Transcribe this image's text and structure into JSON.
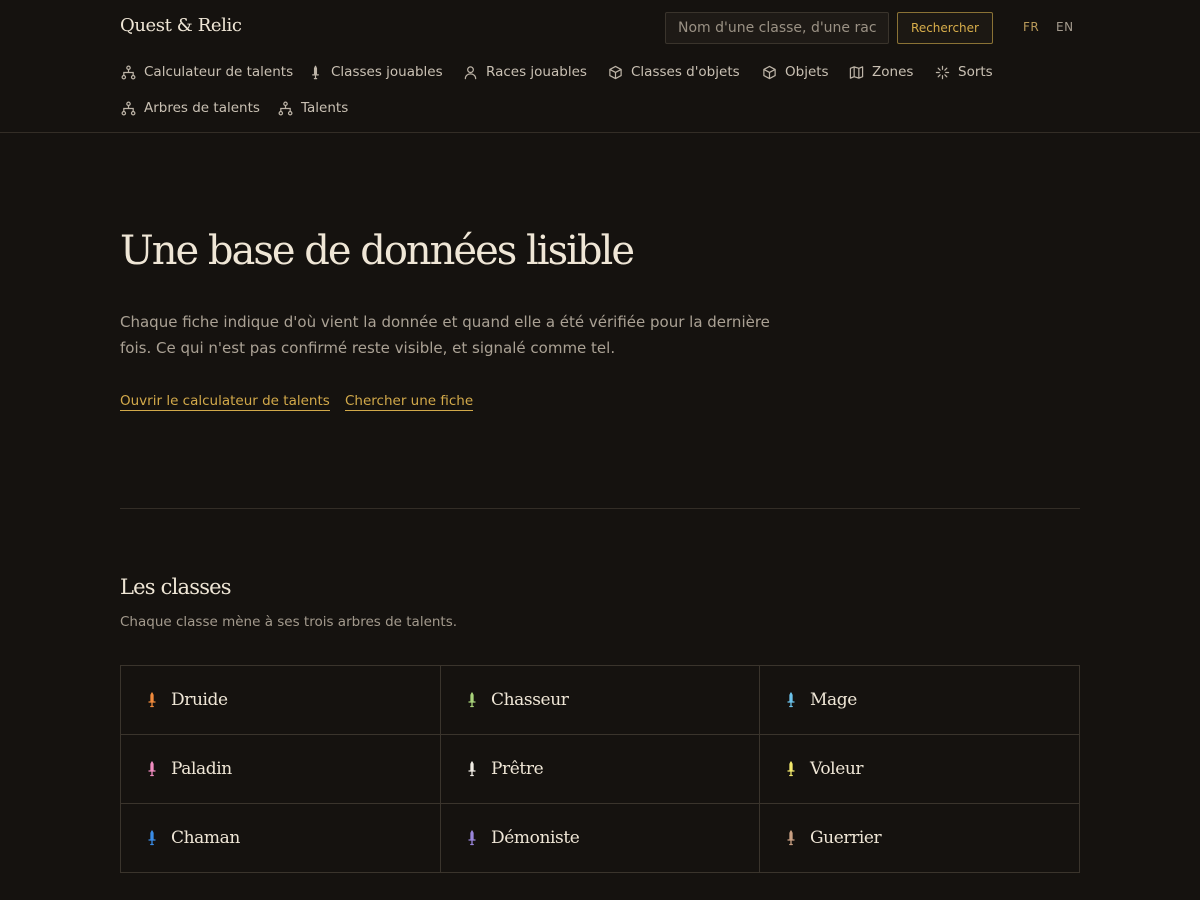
{
  "header": {
    "brand": "Quest & Relic",
    "search": {
      "placeholder": "Nom d'une classe, d'une race, d'un objet",
      "value": "",
      "button_label": "Rechercher"
    },
    "languages": [
      {
        "code": "FR",
        "active": true
      },
      {
        "code": "EN",
        "active": false
      }
    ]
  },
  "nav": {
    "items": [
      {
        "label": "Calculateur de talents",
        "icon": "talent-tree-icon"
      },
      {
        "label": "Classes jouables",
        "icon": "sword-icon"
      },
      {
        "label": "Races jouables",
        "icon": "person-icon"
      },
      {
        "label": "Classes d'objets",
        "icon": "cube-icon"
      },
      {
        "label": "Objets",
        "icon": "cube-icon"
      },
      {
        "label": "Zones",
        "icon": "map-icon"
      },
      {
        "label": "Sorts",
        "icon": "sparkle-icon"
      },
      {
        "label": "Arbres de talents",
        "icon": "talent-tree-icon"
      },
      {
        "label": "Talents",
        "icon": "talent-tree-icon"
      }
    ]
  },
  "hero": {
    "title": "Une base de données lisible",
    "text": "Chaque fiche indique d'où vient la donnée et quand elle a été vérifiée pour la dernière fois. Ce qui n'est pas confirmé reste visible, et signalé comme tel.",
    "links": [
      {
        "label": "Ouvrir le calculateur de talents"
      },
      {
        "label": "Chercher une fiche"
      }
    ]
  },
  "classes_section": {
    "title": "Les classes",
    "subtitle": "Chaque classe mène à ses trois arbres de talents.",
    "classes": [
      {
        "name": "Druide",
        "icon": "sword-icon",
        "color": "#f08a3c"
      },
      {
        "name": "Chasseur",
        "icon": "sword-icon",
        "color": "#a8d27a"
      },
      {
        "name": "Mage",
        "icon": "sword-icon",
        "color": "#6cc2ea"
      },
      {
        "name": "Paladin",
        "icon": "sword-icon",
        "color": "#f08cc0"
      },
      {
        "name": "Prêtre",
        "icon": "sword-icon",
        "color": "#f0ece4"
      },
      {
        "name": "Voleur",
        "icon": "sword-icon",
        "color": "#f2e86c"
      },
      {
        "name": "Chaman",
        "icon": "sword-icon",
        "color": "#3a8ce6"
      },
      {
        "name": "Démoniste",
        "icon": "sword-icon",
        "color": "#9a86dc"
      },
      {
        "name": "Guerrier",
        "icon": "sword-icon",
        "color": "#c9a083"
      }
    ]
  },
  "colors": {
    "background": "#15120f",
    "accent": "#d2a94a",
    "text_primary": "#efe6d6",
    "text_muted": "#a39a8d",
    "border": "#3a342c"
  }
}
